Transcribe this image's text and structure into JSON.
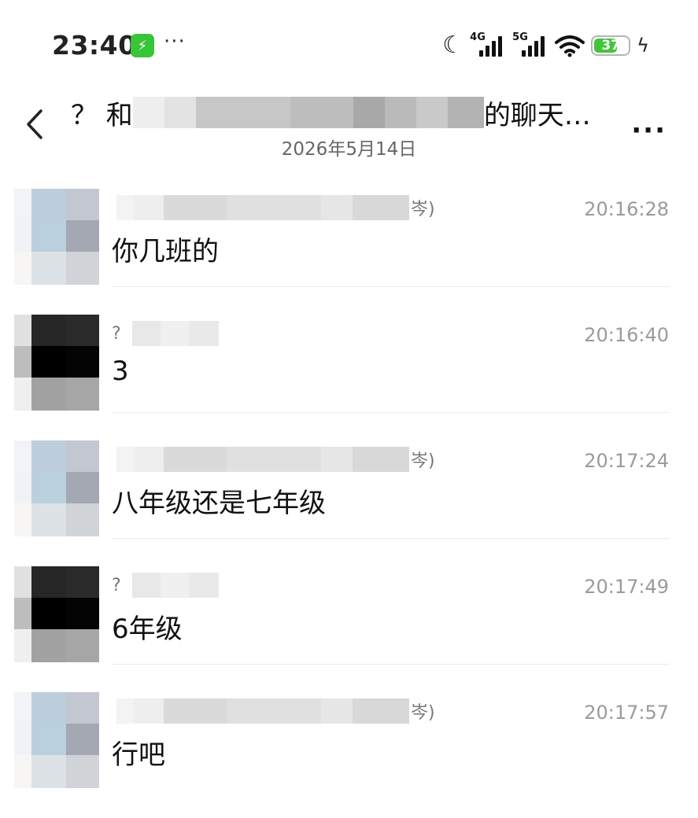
{
  "status_bar": {
    "time": "23:40",
    "more": "···",
    "battery_level": "37",
    "net_1": "4G",
    "net_2": "5G"
  },
  "header": {
    "title_prefix": "？ 和",
    "title_suffix": "的聊天…",
    "date": "2026年5月14日",
    "more": "···"
  },
  "messages": [
    {
      "sender_prefix": "",
      "sender_suffix": "岑)",
      "time": "20:16:28",
      "text": "你几班的",
      "avatar": "a"
    },
    {
      "sender_prefix": "?",
      "sender_suffix": "",
      "time": "20:16:40",
      "text": "3",
      "avatar": "b"
    },
    {
      "sender_prefix": "",
      "sender_suffix": "岑)",
      "time": "20:17:24",
      "text": "八年级还是七年级",
      "avatar": "a"
    },
    {
      "sender_prefix": "?",
      "sender_suffix": "",
      "time": "20:17:49",
      "text": "6年级",
      "avatar": "b"
    },
    {
      "sender_prefix": "",
      "sender_suffix": "岑)",
      "time": "20:17:57",
      "text": "行吧",
      "avatar": "a"
    }
  ],
  "colors": {
    "battery_green": "#44c43b",
    "app_badge_green": "#39c43a",
    "timestamp_gray": "#9a9a9a"
  }
}
